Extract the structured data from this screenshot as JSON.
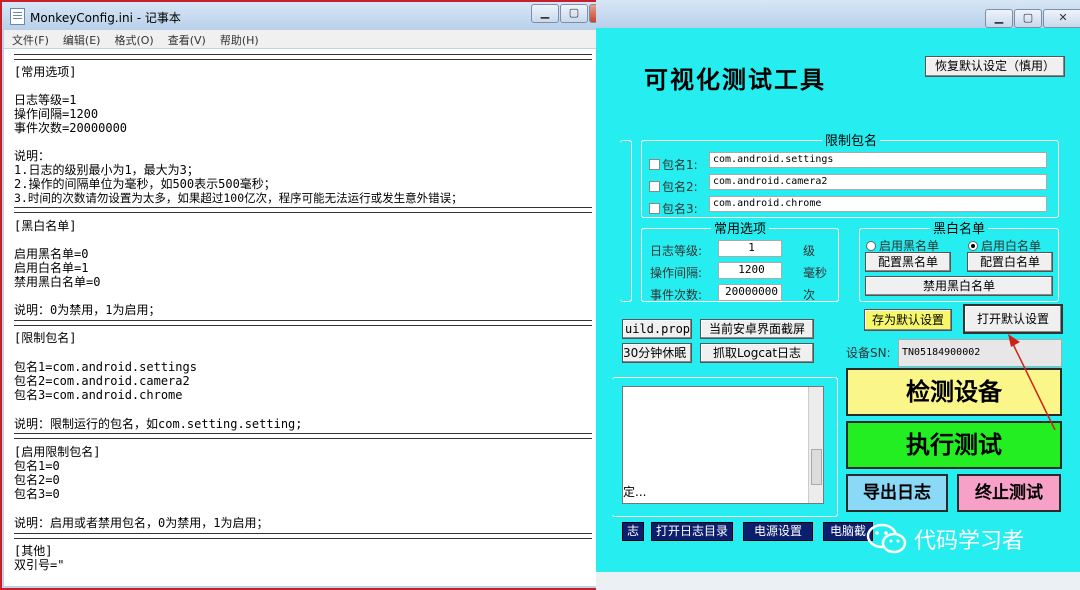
{
  "notepad": {
    "title": "MonkeyConfig.ini - 记事本",
    "menu": [
      "文件(F)",
      "编辑(E)",
      "格式(O)",
      "查看(V)",
      "帮助(H)"
    ],
    "lines": {
      "sec1": "[常用选项]",
      "l1": "日志等级=1",
      "l2": "操作间隔=1200",
      "l3": "事件次数=20000000",
      "l4": "说明：",
      "l5": "1.日志的级别最小为1，最大为3；",
      "l6": "2.操作的间隔单位为毫秒，如500表示500毫秒；",
      "l7": "3.时间的次数请勿设置为太多，如果超过100亿次，程序可能无法运行或发生意外错误；",
      "sec2": "[黑白名单]",
      "l8": "启用黑名单=0",
      "l9": "启用白名单=1",
      "l10": "禁用黑白名单=0",
      "l11": "说明：0为禁用，1为启用；",
      "sec3": "[限制包名]",
      "l12": "包名1=com.android.settings",
      "l13": "包名2=com.android.camera2",
      "l14": "包名3=com.android.chrome",
      "l15": "说明：限制运行的包名，如com.setting.setting;",
      "sec4": "[启用限制包名]",
      "l16": "包名1=0",
      "l17": "包名2=0",
      "l18": "包名3=0",
      "l19": "说明：启用或者禁用包名，0为禁用，1为启用；",
      "sec5": "[其他]",
      "l20": "双引号=\""
    }
  },
  "tool": {
    "app_title": "可视化测试工具",
    "restore_button": "恢复默认设定（慎用）",
    "restrict_group": {
      "label": "限制包名",
      "items": [
        {
          "label": "包名1:",
          "value": "com.android.settings"
        },
        {
          "label": "包名2:",
          "value": "com.android.camera2"
        },
        {
          "label": "包名3:",
          "value": "com.android.chrome"
        }
      ]
    },
    "common_group": {
      "label": "常用选项",
      "rows": [
        {
          "label": "日志等级:",
          "value": "1",
          "unit": "级"
        },
        {
          "label": "操作间隔:",
          "value": "1200",
          "unit": "毫秒"
        },
        {
          "label": "事件次数:",
          "value": "20000000",
          "unit": "次"
        }
      ]
    },
    "bw_group": {
      "label": "黑白名单",
      "radio_black": "启用黑名单",
      "radio_white": "启用白名单",
      "btn_black": "配置黑名单",
      "btn_white": "配置白名单",
      "btn_disable": "禁用黑白名单"
    },
    "save_default": "存为默认设置",
    "open_default": "打开默认设置",
    "build_prop": "uild.prop",
    "screenshot": "当前安卓界面截屏",
    "sleep": "30分钟休眠",
    "logcat": "抓取Logcat日志",
    "device_sn_label": "设备SN:",
    "device_sn_value": "TN05184900002",
    "detect": "检测设备",
    "execute": "执行测试",
    "export": "导出日志",
    "stop": "终止测试",
    "log_text": "定...",
    "bottom_buttons": [
      "志",
      "打开日志目录",
      "电源设置",
      "电脑截"
    ],
    "colors": {
      "body": "#26eef0",
      "detect": "#fbf68a",
      "execute": "#22ee22",
      "export": "#8ad9f7",
      "stop": "#f7a0c8"
    }
  },
  "watermark": "代码学习者"
}
